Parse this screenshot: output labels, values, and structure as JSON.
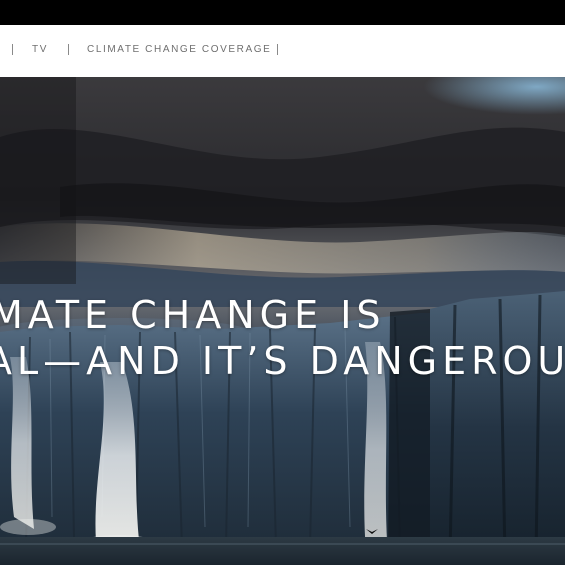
{
  "nav": {
    "items": [
      {
        "label": "TV"
      },
      {
        "label": "CLIMATE CHANGE COVERAGE"
      }
    ]
  },
  "hero": {
    "headline_line1": "MATE CHANGE IS",
    "headline_line2": "AL—AND IT’S DANGEROU",
    "image_subject": "glacier-cliffs-with-waterfalls-under-storm-clouds"
  },
  "colors": {
    "topbar": "#000000",
    "navbar_bg": "#ffffff",
    "nav_text": "#6f6f6f",
    "headline_text": "#ffffff"
  }
}
